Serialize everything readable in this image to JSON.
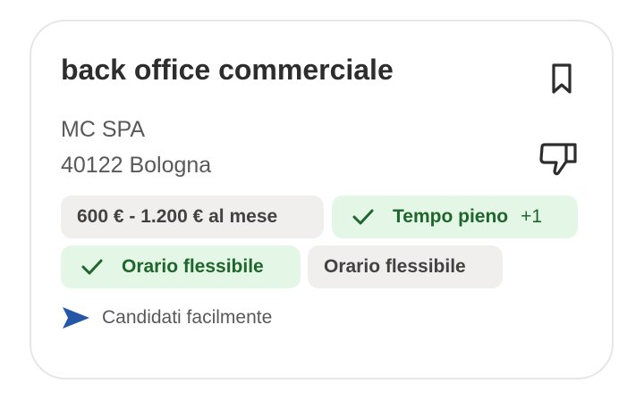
{
  "job": {
    "title": "back office commerciale",
    "company": "MC SPA",
    "location": "40122 Bologna"
  },
  "chips": {
    "salary": "600 € - 1.200 € al mese",
    "fulltime": "Tempo pieno",
    "fulltime_extra": "+1",
    "flex_green": "Orario flessibile",
    "flex_gray": "Orario flessibile"
  },
  "easy_apply": {
    "label": "Candidati facilmente"
  },
  "icons": {
    "bookmark": "bookmark-icon",
    "dislike": "thumbs-down-icon",
    "check": "check-icon",
    "send": "send-arrow-icon"
  },
  "colors": {
    "title": "#2d2d2d",
    "secondary_text": "#595959",
    "gray_chip": "#f0efee",
    "green_chip": "#e4f7e6",
    "green_text": "#1f662c",
    "accent_blue": "#2557a7"
  }
}
